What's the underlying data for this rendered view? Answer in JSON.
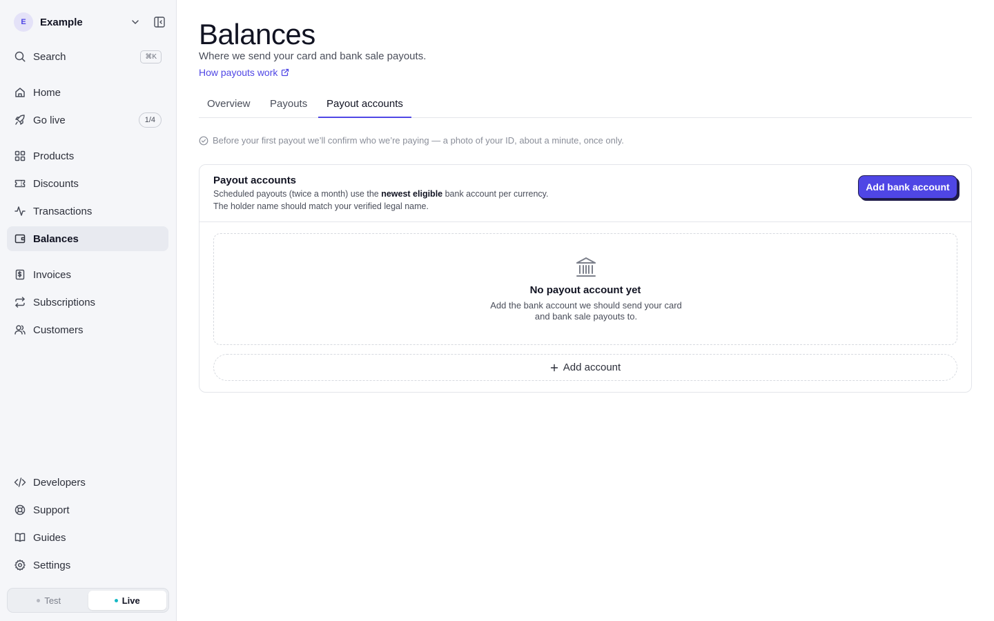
{
  "workspace": {
    "initial": "E",
    "name": "Example"
  },
  "sidebar": {
    "search": {
      "label": "Search",
      "shortcut": "⌘K"
    },
    "items": [
      {
        "label": "Home",
        "icon": "home-icon"
      },
      {
        "label": "Go live",
        "icon": "rocket-icon",
        "badge": "1/4"
      },
      {
        "label": "Products",
        "icon": "grid-icon"
      },
      {
        "label": "Discounts",
        "icon": "ticket-icon"
      },
      {
        "label": "Transactions",
        "icon": "activity-icon"
      },
      {
        "label": "Balances",
        "icon": "wallet-icon",
        "active": true
      },
      {
        "label": "Invoices",
        "icon": "invoice-icon"
      },
      {
        "label": "Subscriptions",
        "icon": "repeat-icon"
      },
      {
        "label": "Customers",
        "icon": "users-icon"
      }
    ],
    "footer_items": [
      {
        "label": "Developers",
        "icon": "code-icon"
      },
      {
        "label": "Support",
        "icon": "lifebuoy-icon"
      },
      {
        "label": "Guides",
        "icon": "book-icon"
      },
      {
        "label": "Settings",
        "icon": "gear-icon"
      }
    ],
    "mode": {
      "test_label": "Test",
      "live_label": "Live",
      "selected": "Live"
    }
  },
  "page": {
    "title": "Balances",
    "subtitle": "Where we send your card and bank sale payouts.",
    "help_link": "How payouts work",
    "tabs": [
      {
        "label": "Overview"
      },
      {
        "label": "Payouts"
      },
      {
        "label": "Payout accounts",
        "active": true
      }
    ],
    "notice": "Before your first payout we’ll confirm who we’re paying — a photo of your ID, about a minute, once only."
  },
  "payout_card": {
    "title": "Payout accounts",
    "desc_pre": "Scheduled payouts (twice a month) use the ",
    "desc_bold": "newest eligible",
    "desc_post": " bank account per currency.",
    "desc_line2": "The holder name should match your verified legal name.",
    "add_button": "Add bank account",
    "empty_title": "No payout account yet",
    "empty_desc": "Add the bank account we should send your card and bank sale payouts to.",
    "add_row_label": "Add account"
  },
  "colors": {
    "accent": "#4f46e5",
    "live_dot": "#14b8c4",
    "test_dot": "#b5b8c0"
  }
}
